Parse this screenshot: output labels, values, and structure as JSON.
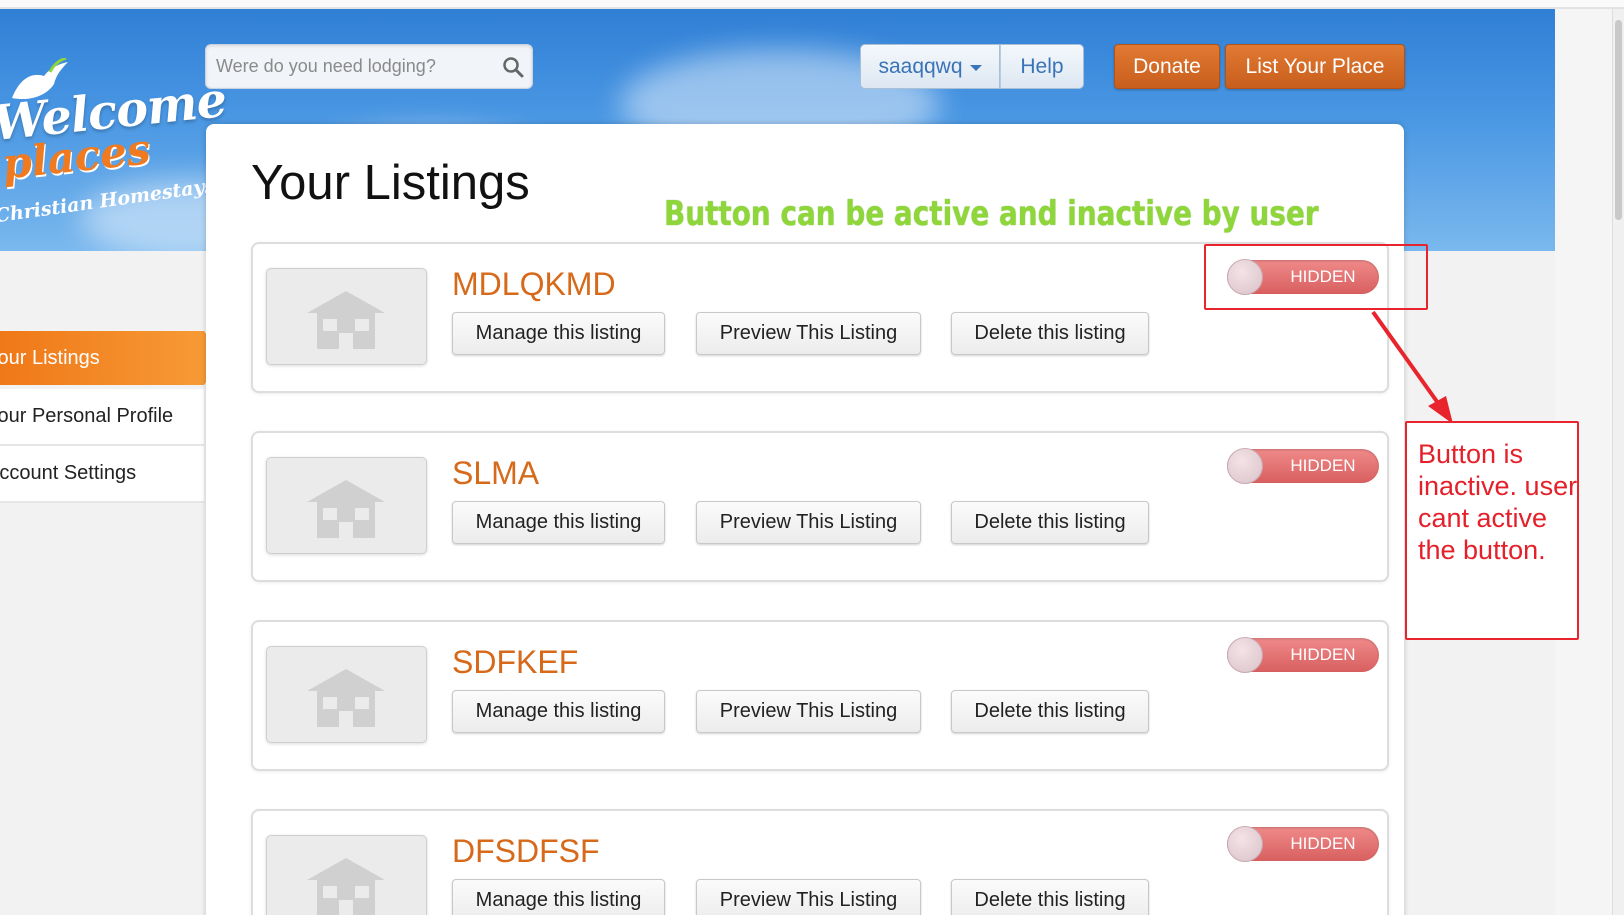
{
  "logo": {
    "line1": "Welcome",
    "line2": "places",
    "line3": "Christian Homestays"
  },
  "search": {
    "placeholder": "Were do you need lodging?"
  },
  "header": {
    "user_label": "saaqqwq",
    "help_label": "Help",
    "donate_label": "Donate",
    "list_place_label": "List Your Place"
  },
  "sidebar": {
    "items": [
      {
        "label": "Your Listings",
        "active": true
      },
      {
        "label": "Your Personal Profile",
        "active": false
      },
      {
        "label": "Account Settings",
        "active": false
      }
    ]
  },
  "page": {
    "title": "Your Listings"
  },
  "listings": [
    {
      "name": "MDLQKMD",
      "status": "HIDDEN",
      "manage": "Manage this listing",
      "preview": "Preview This Listing",
      "delete": "Delete this listing"
    },
    {
      "name": "SLMA",
      "status": "HIDDEN",
      "manage": "Manage this listing",
      "preview": "Preview This Listing",
      "delete": "Delete this listing"
    },
    {
      "name": "SDFKEF",
      "status": "HIDDEN",
      "manage": "Manage this listing",
      "preview": "Preview This Listing",
      "delete": "Delete this listing"
    },
    {
      "name": "DFSDFSF",
      "status": "HIDDEN",
      "manage": "Manage this listing",
      "preview": "Preview This Listing",
      "delete": "Delete this listing"
    }
  ],
  "annotations": {
    "green_note": "Button can be active and inactive by user",
    "red_note": "Button is inactive. user cant active the button."
  },
  "colors": {
    "accent_orange": "#d66a1a",
    "header_blue": "#2f7fd6",
    "toggle_red": "#d85f5f",
    "annotation_red": "#e4202a",
    "annotation_green": "#8ed63a"
  }
}
